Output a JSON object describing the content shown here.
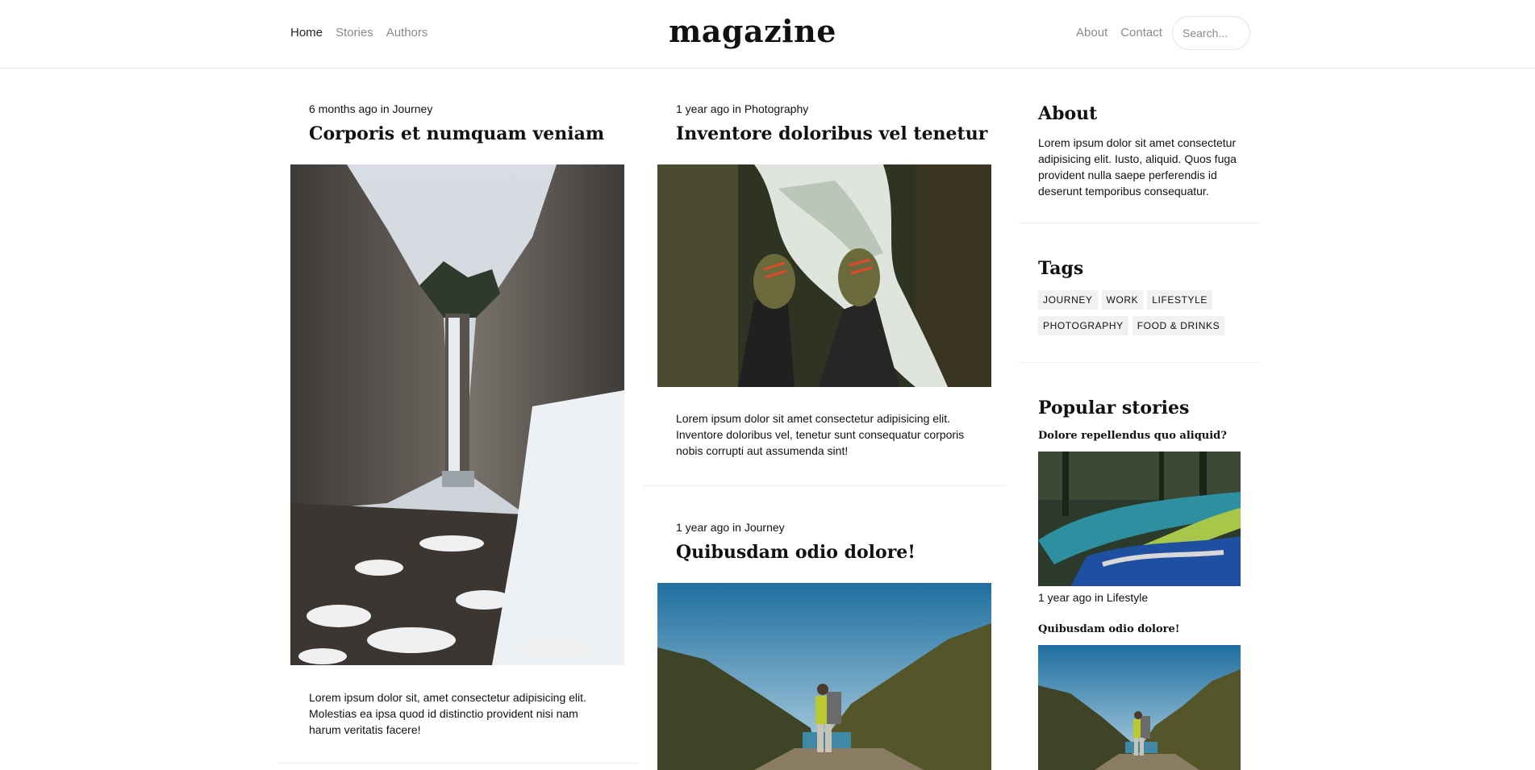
{
  "header": {
    "logo": "magazine",
    "nav_left": [
      "Home",
      "Stories",
      "Authors"
    ],
    "nav_right": [
      "About",
      "Contact"
    ],
    "search_placeholder": "Search..."
  },
  "posts": [
    {
      "meta": "6 months ago in Journey",
      "title": "Corporis et numquam veniam",
      "excerpt": "Lorem ipsum dolor sit, amet consectetur adipisicing elit. Molestias ea ipsa quod id distinctio provident nisi nam harum veritatis facere!"
    },
    {
      "meta": "1 year ago in Photography",
      "title": "Inventore doloribus vel tenetur",
      "excerpt": "Lorem ipsum dolor sit amet consectetur adipisicing elit. Inventore doloribus vel, tenetur sunt consequatur corporis nobis corrupti aut assumenda sint!"
    },
    {
      "meta": "1 year ago in Journey",
      "title": "Quibusdam odio dolore!"
    }
  ],
  "sidebar": {
    "about_heading": "About",
    "about_text": "Lorem ipsum dolor sit amet consectetur adipisicing elit. Iusto, aliquid. Quos fuga provident nulla saepe perferendis id deserunt temporibus consequatur.",
    "tags_heading": "Tags",
    "tags": [
      "JOURNEY",
      "WORK",
      "LIFESTYLE",
      "PHOTOGRAPHY",
      "FOOD & DRINKS"
    ],
    "popular_heading": "Popular stories",
    "popular": [
      {
        "title": "Dolore repellendus quo aliquid?",
        "meta": "1 year ago in Lifestyle"
      },
      {
        "title": "Quibusdam odio dolore!"
      }
    ]
  }
}
